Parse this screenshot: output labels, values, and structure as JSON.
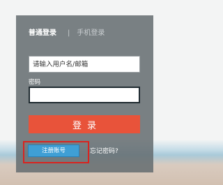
{
  "tabs": {
    "active": "普通登录",
    "separator": "|",
    "inactive": "手机登录"
  },
  "username": {
    "placeholder": "请输入用户名/邮箱",
    "value": ""
  },
  "password": {
    "label": "密码",
    "value": ""
  },
  "login_label": "登录",
  "register_label": "注册账号",
  "forgot_label": "忘记密码?",
  "colors": {
    "login_button": "#e8533a",
    "register_button": "#3f9fd5",
    "highlight_box": "#d9231f"
  }
}
